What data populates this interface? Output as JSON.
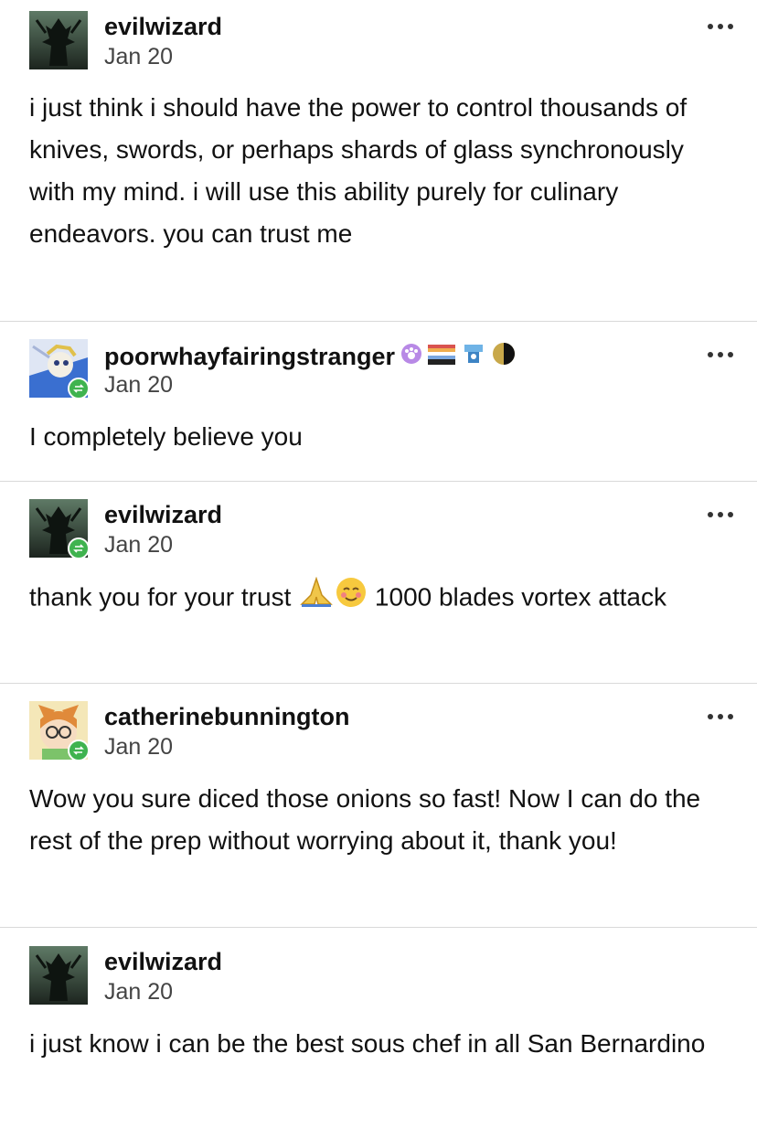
{
  "posts": [
    {
      "username": "evilwizard",
      "date": "Jan 20",
      "text": "i just think i should have the power to control thousands of knives, swords, or perhaps shards of glass synchronously with my mind. i will use this ability purely for culinary endeavors. you can trust me"
    },
    {
      "username": "poorwhayfairingstranger",
      "date": "Jan 20",
      "text": "I completely believe you"
    },
    {
      "username": "evilwizard",
      "date": "Jan 20",
      "text_before": "thank you for your trust ",
      "text_after": " 1000 blades vortex attack"
    },
    {
      "username": "catherinebunnington",
      "date": "Jan 20",
      "text": "Wow you sure diced those onions so fast! Now I can do the rest of the prep without worrying about it, thank you!"
    },
    {
      "username": "evilwizard",
      "date": "Jan 20",
      "text": "i just know i can be the best sous chef in all San Bernardino"
    }
  ],
  "icons": {
    "more": "more-options-icon",
    "reblog": "reblog-icon",
    "pray": "folded-hands-emoji",
    "smile": "smiling-face-emoji"
  },
  "colors": {
    "reblog_badge": "#3fb34f",
    "divider": "#d9d9d9"
  }
}
